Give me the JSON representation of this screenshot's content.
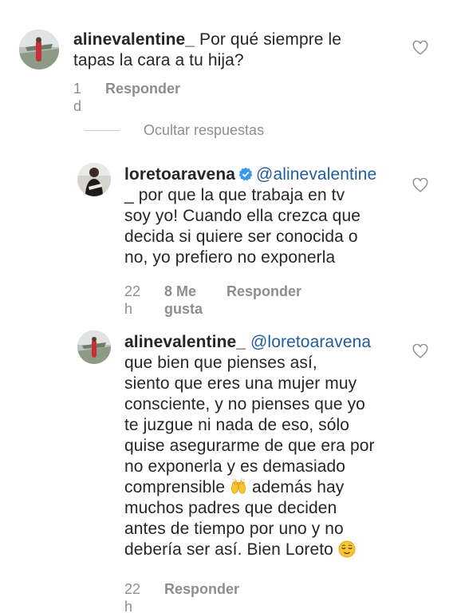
{
  "comments": [
    {
      "username": "alinevalentine_",
      "text_line1": "Por qué siempre le",
      "text_line2": "tapas la cara a tu hija?",
      "time": "1 d",
      "reply_label": "Responder"
    },
    {
      "username": "loretoaravena",
      "mention": "@alinevalentine",
      "text_line1": "_ por que la que trabaja en tv",
      "text_line2": "soy yo! Cuando ella crezca que",
      "text_line3": "decida si quiere ser conocida o",
      "text_line4": "no, yo prefiero no exponerla",
      "time": "22 h",
      "likes": "8 Me gusta",
      "reply_label": "Responder"
    },
    {
      "username": "alinevalentine_",
      "mention": "@loretoaravena",
      "text_line1": "que bien que pienses así,",
      "text_line2": "siento que eres una mujer muy",
      "text_line3": "consciente, y no pienses que yo",
      "text_line4": "te juzgue ni nada de eso, sólo",
      "text_line5": "quise asegurarme de que era por",
      "text_line6": "no exponerla y es demasiado",
      "text_line7a": "comprensible",
      "text_line7b": "además hay",
      "text_line8": "muchos padres que deciden",
      "text_line9": "antes de tiempo por uno y no",
      "text_line10": "debería ser así. Bien Loreto",
      "time": "22 h",
      "reply_label": "Responder"
    }
  ],
  "hide_replies_label": "Ocultar respuestas",
  "icons": {
    "like": "heart-outline-icon",
    "verified": "verified-badge-icon",
    "emoji_hands": "raising-hands-emoji",
    "emoji_face": "relieved-face-emoji"
  },
  "colors": {
    "text": "#262626",
    "secondary": "#8e8e8e",
    "mention": "#1f5c9e",
    "verified": "#3897f0"
  }
}
